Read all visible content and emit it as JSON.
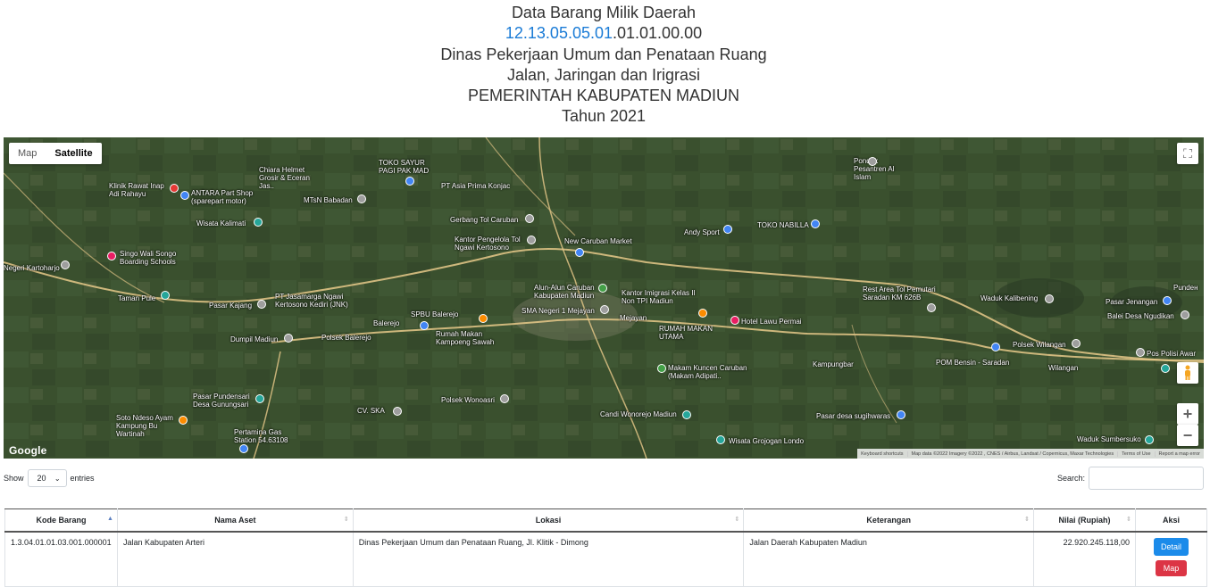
{
  "header": {
    "line1": "Data Barang Milik Daerah",
    "code_blue": "12.13.05.05.01",
    "code_rest": ".01.01.00.00",
    "line3": "Dinas Pekerjaan Umum dan Penataan Ruang",
    "line4": "Jalan, Jaringan dan Irigrasi",
    "line5": "PEMERINTAH KABUPATEN MADIUN",
    "line6": "Tahun 2021"
  },
  "map": {
    "type_map": "Map",
    "type_satellite": "Satellite",
    "google_logo": "Google",
    "attribution": [
      "Keyboard shortcuts",
      "Map data ©2022 Imagery ©2022 , CNES / Airbus, Landsat / Copernicus, Maxar Technologies",
      "Terms of Use",
      "Report a map error"
    ],
    "fullscreen_icon": "fullscreen-icon",
    "labels": [
      "Chiara Helmet Grosir & Eceran Jas..",
      "TOKO SAYUR PAGI PAK MAD",
      "Pondok Pesantren Al Islam",
      "Klinik Rawat Inap Adi Rahayu",
      "ANTARA Part Shop (sparepart motor)",
      "MTsN Babadan",
      "PT Asia Prima Konjac",
      "Gerbang Tol Caruban",
      "Wisata Kalimati",
      "Kantor Pengelola Tol Ngawi Kertosono",
      "New Caruban Market",
      "Andy Sport",
      "TOKO NABILLA",
      "Singo Wali Songo Boarding Schools",
      "Negeri Kartoharjo",
      "Taman Pule",
      "Pasar Kajang",
      "PT Jasamarga Ngawi Kertosono Kediri (JNK)",
      "Alun-Alun Caruban Kabupaten Madiun",
      "Kantor Imigrasi Kelas II Non TPI Madiun",
      "SMA Negeri 1 Mejayan",
      "Rest Area Tol Pemutari Saradan KM 626B",
      "Waduk Kalibening",
      "Pasar Jenangan",
      "Balei Desa Ngudikan",
      "Dumpil Madiun",
      "Polsek Balerejo",
      "Balerejo",
      "SPBU Balerejo",
      "Rumah Makan Kampoeng Sawah",
      "Mejayan",
      "RUMAH MAKAN UTAMA",
      "Hotel Lawu Permai",
      "Kampungbar",
      "POM Bensin - Saradan",
      "Polsek Wilangan",
      "Wilangan",
      "Pos Polisi Awar",
      "Makam Kuncen Caruban (Makam Adipati..",
      "Pasar Pundensari Desa Gunungsari",
      "Polsek Wonoasri",
      "CV. SKA",
      "Candi Wonorejo Madiun",
      "Pasar desa sugihwaras",
      "Soto Ndeso Ayam Kampung Bu Wartinah",
      "Pertamina Gas Station 54.63108",
      "Wisata Grojogan Londo",
      "Waduk Sumbersuko",
      "Pundeн"
    ]
  },
  "table_controls": {
    "show_label": "Show",
    "entries_value": "20",
    "entries_label": "entries",
    "search_label": "Search:"
  },
  "table": {
    "columns": [
      "Kode Barang",
      "Nama Aset",
      "Lokasi",
      "Keterangan",
      "Nilai (Rupiah)",
      "Aksi"
    ],
    "rows": [
      {
        "kode": "1.3.04.01.01.03.001.000001",
        "nama": "Jalan Kabupaten Arteri",
        "lokasi": "Dinas Pekerjaan Umum dan Penataan Ruang, Jl. Klitik - Dimong",
        "keterangan": "Jalan Daerah Kabupaten Madiun",
        "nilai": "22.920.245.118,00",
        "btn_detail": "Detail",
        "btn_map": "Map"
      }
    ]
  }
}
